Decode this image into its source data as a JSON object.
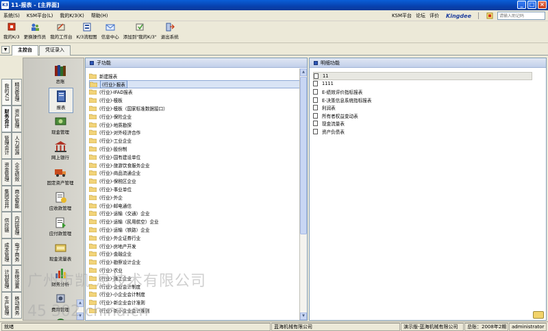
{
  "window": {
    "app_icon": "K3",
    "title": "11-报表 - [主界面]",
    "buttons": [
      "_",
      "□",
      "×"
    ],
    "colors": {
      "titlebar": "#0842b0",
      "selection": "#c7d7f0"
    }
  },
  "menubar": {
    "items": [
      "系统(S)",
      "KSM平台(L)",
      "我的K/3(K)",
      "帮助(H)"
    ],
    "right_links": [
      "KSM平台",
      "论坛",
      "评价"
    ],
    "brand": "Kingdee",
    "help_placeholder": "请输入助记码"
  },
  "toolbar": {
    "buttons": [
      {
        "label": "我的K/3",
        "icon": "my-k3-icon"
      },
      {
        "label": "更换操作员",
        "icon": "switch-user-icon"
      },
      {
        "label": "我的工作台",
        "icon": "workbench-icon"
      },
      {
        "label": "K/3流程图",
        "icon": "flowchart-icon"
      },
      {
        "label": "信息中心",
        "icon": "message-icon"
      },
      {
        "label": "添加到\"我的K/3\"",
        "icon": "add-favorite-icon"
      },
      {
        "label": "退出系统",
        "icon": "exit-icon"
      }
    ]
  },
  "tabs": {
    "arrow": "▼",
    "items": [
      "主控台",
      "凭证录入"
    ]
  },
  "left_tabs": {
    "column1": [
      "我的K/3",
      "财务会计",
      "管理会计",
      "资金管理",
      "集团合并",
      "供应链",
      "成本管理",
      "计划管理",
      "生产管理"
    ],
    "column2": [
      "精益管理",
      "资产管理",
      "人力资源",
      "企业绩效",
      "商业智能",
      "内控管理",
      "电子商务",
      "系统设置",
      "移动商务"
    ]
  },
  "modules": {
    "items": [
      "总账",
      "报表",
      "现金管理",
      "网上银行",
      "固定资产管理",
      "应收款管理",
      "应付款管理",
      "现金流量表",
      "财务分析",
      "费用管理",
      ""
    ],
    "selected": 1
  },
  "sub_panel": {
    "header": "子功能",
    "items": [
      "新建报表",
      "(行业)-报表",
      "(行业)-IFAD报表",
      "(行业)-模板",
      "(行业)-模板（国家标准数据接口）",
      "(行业)-保险企业",
      "(行业)-地质勘探",
      "(行业)-对外经济合作",
      "(行业)-工业企业",
      "(行业)-股份制",
      "(行业)-国有建设单位",
      "(行业)-旅游饮食服务企业",
      "(行业)-商品流通企业",
      "(行业)-保税区企业",
      "(行业)-事业单位",
      "(行业)-外企",
      "(行业)-邮电通信",
      "(行业)-运输（交通）企业",
      "(行业)-运输（民用航空）企业",
      "(行业)-运输（铁路）企业",
      "(行业)-外企证券行业",
      "(行业)-房地产开发",
      "(行业)-金融企业",
      "(行业)-勘察设计企业",
      "(行业)-农业",
      "(行业)-施工企业",
      "(行业)-企业会计制度",
      "(行业)-小企业会计制度",
      "(行业)-新企业会计准则",
      "(行业)-新小企业会计准则"
    ],
    "selected": 1
  },
  "detail_panel": {
    "header": "明细功能",
    "items": [
      "11",
      "1111",
      "E-绩效评价指标报表",
      "E-决策信息系统指标报表",
      "利润表",
      "所有者权益变动表",
      "现金流量表",
      "资产负债表"
    ],
    "selected": 0
  },
  "statusbar": {
    "left": "就绪",
    "company": "蓝海机械有限公司",
    "demo": "演示版-蓝海机械有限公司",
    "period": "总账：2008年2期",
    "user": "administrator"
  },
  "watermark": {
    "line1": "广州市凯  息技术有限公司",
    "line2": "45  302   china.cn"
  }
}
